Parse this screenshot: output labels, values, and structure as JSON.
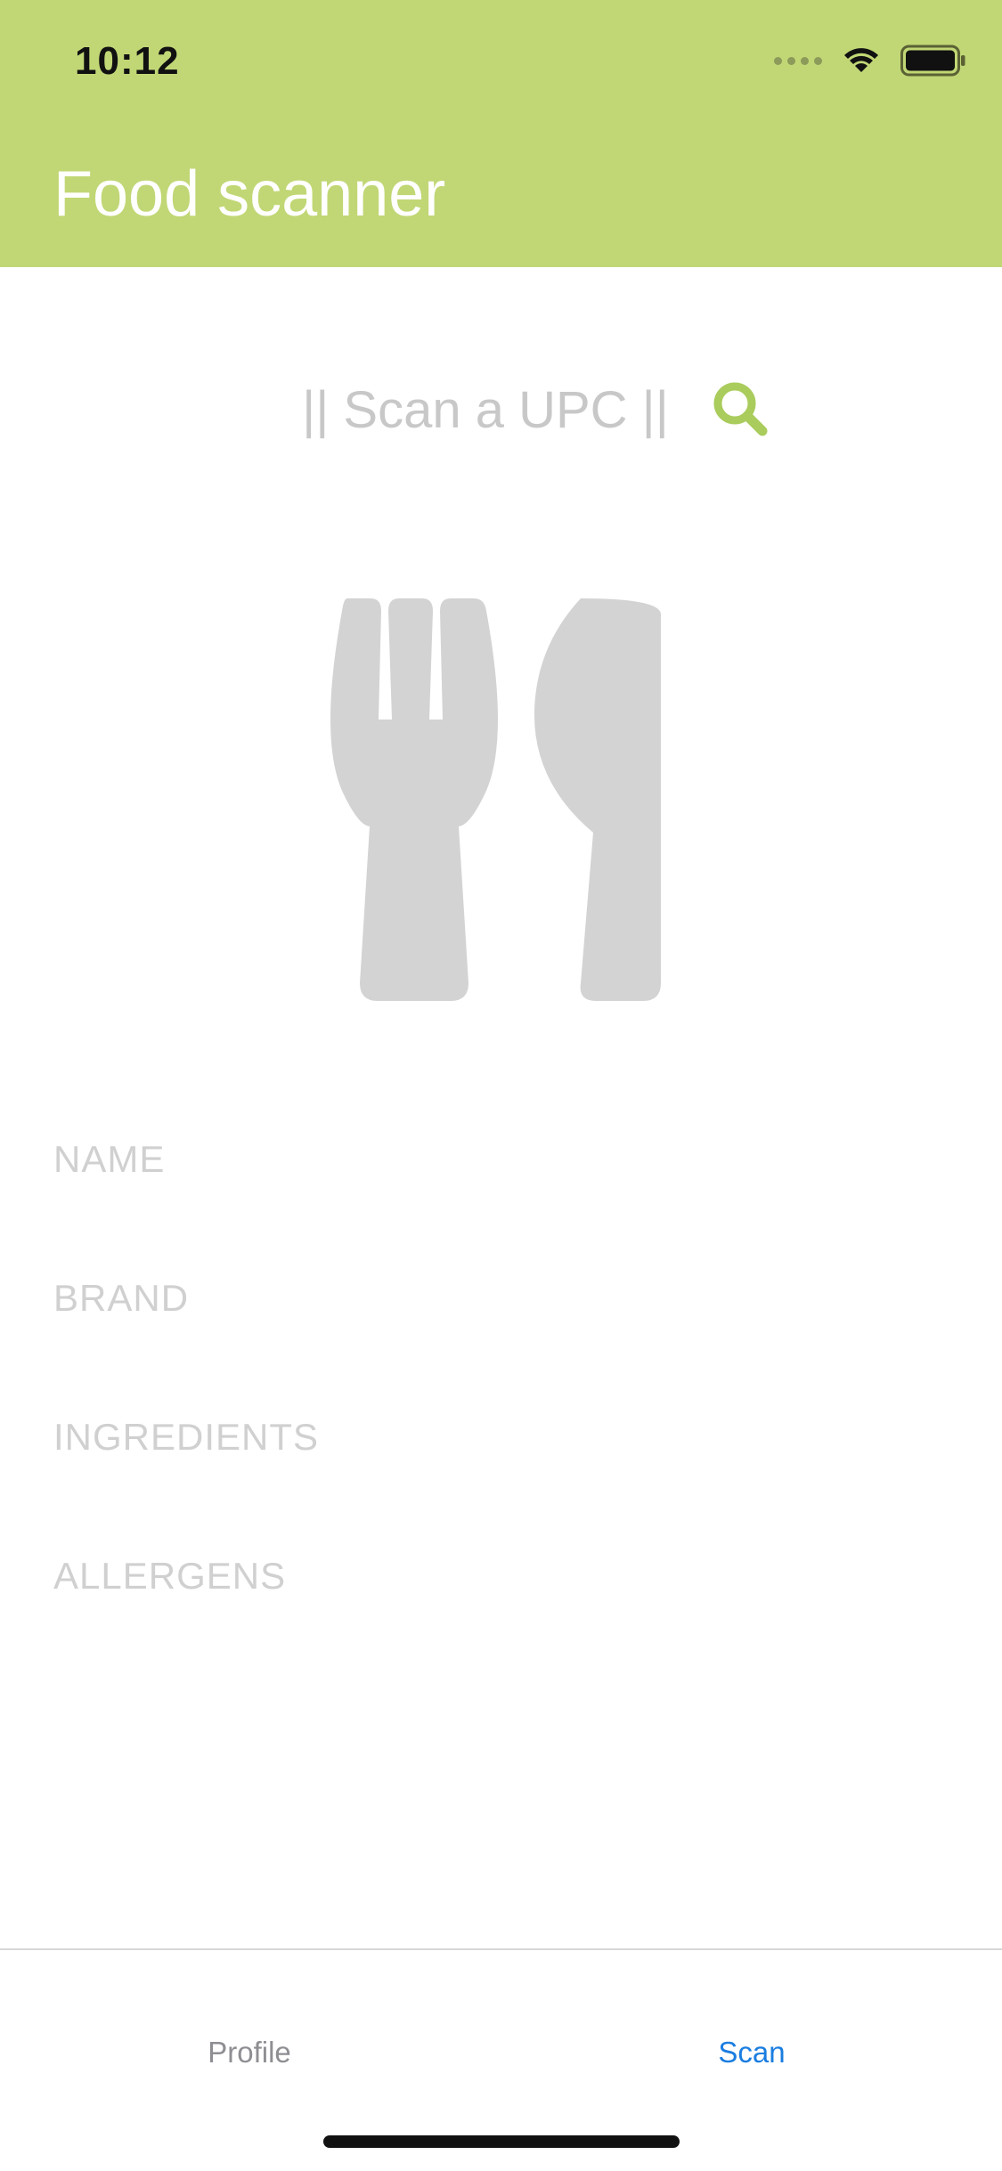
{
  "status_bar": {
    "time": "10:12"
  },
  "header": {
    "title": "Food scanner",
    "background_color": "#c1d775"
  },
  "search": {
    "placeholder": "|| Scan a UPC ||",
    "value": "",
    "icon": "search-icon",
    "icon_color": "#a9cc5c"
  },
  "illustration": {
    "icon": "fork-knife-icon",
    "color": "#d3d3d3"
  },
  "fields": {
    "name_label": "NAME",
    "brand_label": "BRAND",
    "ingredients_label": "INGREDIENTS",
    "allergens_label": "ALLERGENS"
  },
  "tabbar": {
    "profile_label": "Profile",
    "scan_label": "Scan",
    "active_tab": "Scan",
    "active_color": "#1a7de0",
    "inactive_color": "#8e8e93"
  }
}
